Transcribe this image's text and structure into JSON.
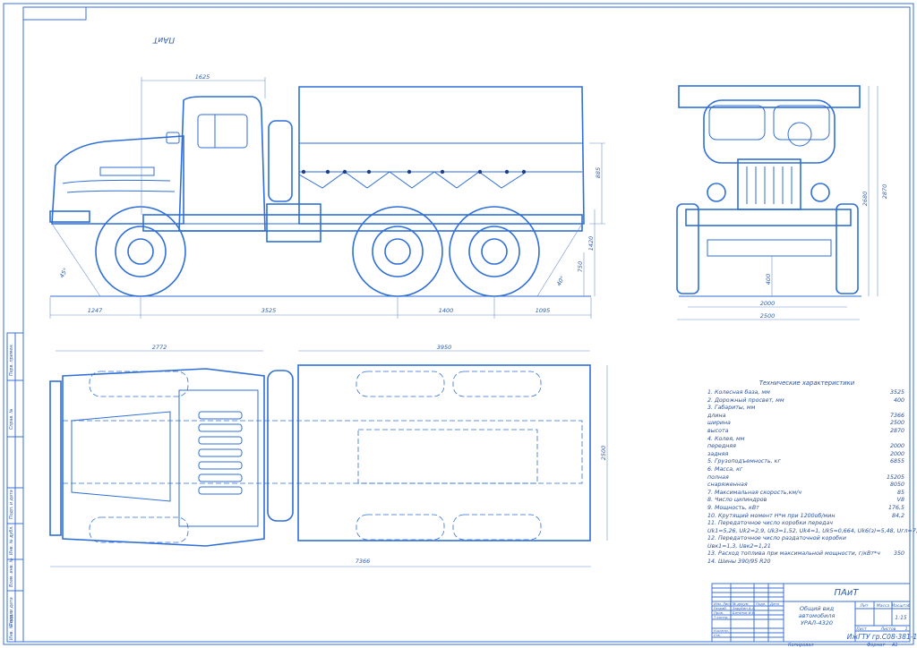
{
  "corner_stamp": "ПАиТ",
  "dimensions": {
    "cab_length": "1625",
    "front_overhang": "1247",
    "wheelbase_front": "3525",
    "wheelbase_rear": "1400",
    "rear_overhang": "1095",
    "body_height": "885",
    "platform_height": "1420",
    "rear_height": "750",
    "angle_front": "45°",
    "angle_rear": "40°",
    "clearance": "400",
    "track": "2000",
    "width": "2500",
    "height_to_cab": "2680",
    "overall_height": "2870",
    "top_front": "2772",
    "top_body": "3950",
    "top_width": "2500",
    "top_total": "7366"
  },
  "specs": {
    "title": "Технические характеристики",
    "rows": [
      {
        "label": "1. Колесная база, мм",
        "value": "3525"
      },
      {
        "label": "2. Дорожный просвет, мм",
        "value": "400"
      },
      {
        "label": "3. Габариты, мм",
        "value": ""
      },
      {
        "label": "длина",
        "value": "7366"
      },
      {
        "label": "ширина",
        "value": "2500"
      },
      {
        "label": "высота",
        "value": "2870"
      },
      {
        "label": "4. Колея, мм",
        "value": ""
      },
      {
        "label": "передняя",
        "value": "2000"
      },
      {
        "label": "задняя",
        "value": "2000"
      },
      {
        "label": "5. Грузоподъемность, кг",
        "value": "6855"
      },
      {
        "label": "6. Масса, кг",
        "value": ""
      },
      {
        "label": "полная",
        "value": "15205"
      },
      {
        "label": "снаряженная",
        "value": "8050"
      },
      {
        "label": "7. Максимальная скорость,км/ч",
        "value": "85"
      },
      {
        "label": "8. Число цилиндров",
        "value": "V8"
      },
      {
        "label": "9. Мощность, кВт",
        "value": "176,5"
      },
      {
        "label": "10. Крутящий момент Н*м при 1200об/мин",
        "value": "84,2"
      },
      {
        "label": "11. Передаточное число коробки передач",
        "value": ""
      },
      {
        "label": "Uk1=5,26, Uk2=2,9, Uk3=1,52, Uk4=1, Uk5=0,664, Uk6(з)=5,48, Uгл=7,32",
        "value": ""
      },
      {
        "label": "12. Передаточное число раздаточной коробки",
        "value": ""
      },
      {
        "label": "Uвк1=1,3, Uвк2=1,21",
        "value": ""
      },
      {
        "label": "13. Расход топлива при максимальной мощности, г/кВт*ч",
        "value": "350"
      },
      {
        "label": "14. Шины 390/95 R20",
        "value": ""
      }
    ]
  },
  "title_block": {
    "org_short": "ПАиТ",
    "doc_title_1": "Общий вид",
    "doc_title_2": "автомобиля",
    "doc_title_3": "УРАЛ-4320",
    "lit_hdr": "Лит",
    "mass_hdr": "Масса",
    "scale_hdr": "Масштаб",
    "scale": "1:15",
    "sheet_lbl": "Лист",
    "sheets_lbl": "Листов",
    "sheets": "1",
    "code": "ИжГТУ гр.С08-381-1",
    "hdr_izm": "Изм.",
    "hdr_list": "Лист",
    "hdr_doc": "№ докум.",
    "hdr_sign": "Подп.",
    "hdr_date": "Дата",
    "r_razrab": "Разраб.",
    "r_prov": "Пров.",
    "r_tkontr": "Т.контр.",
    "r_nkontr": "Н.контр.",
    "r_utv": "Утв.",
    "name_razrab": "Зарубин А.А.",
    "name_prov": "Батанов И.В.",
    "kopiroval": "Копировал",
    "format": "Формат",
    "format_val": "А1"
  },
  "side_strip": [
    "Перв. примен.",
    "Справ. №",
    "Подп. и дата",
    "Инв. № дубл.",
    "Взам. инв. №",
    "Подп. и дата",
    "Инв. № подл."
  ]
}
